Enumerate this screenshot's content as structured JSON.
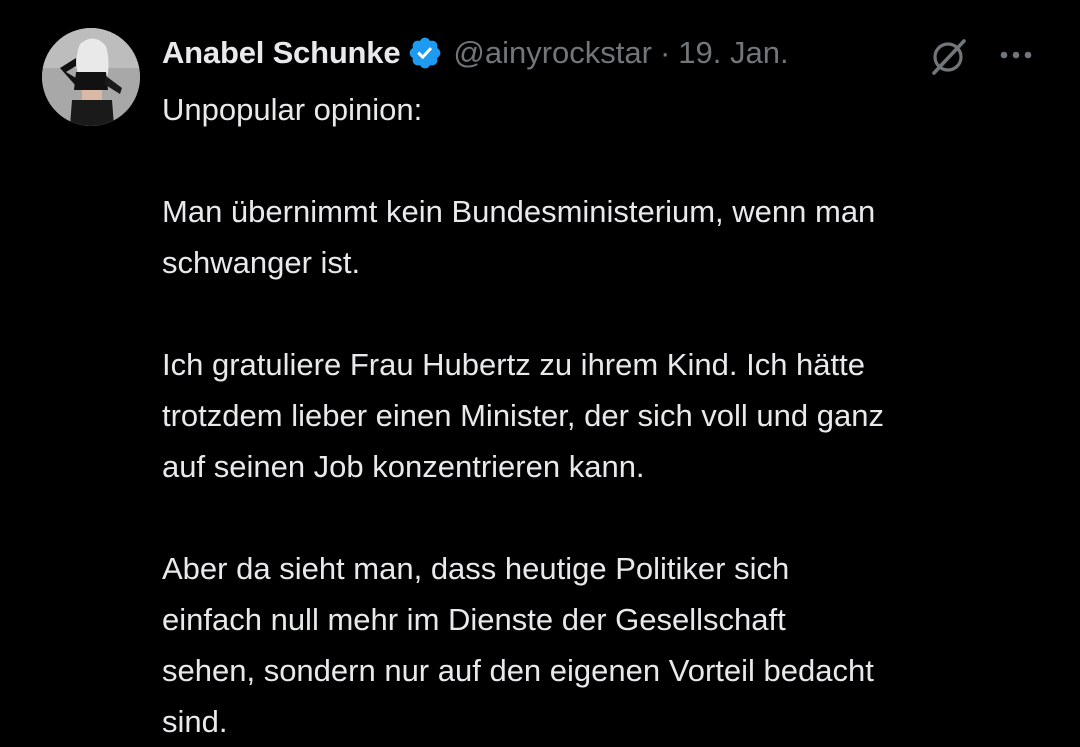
{
  "tweet": {
    "author": {
      "display_name": "Anabel Schunke",
      "handle": "@ainyrockstar",
      "verified": true
    },
    "separator": "·",
    "date": "19. Jan.",
    "paragraphs": [
      [
        "Unpopular opinion:"
      ],
      [
        "Man übernimmt kein Bundesministerium, wenn man",
        "schwanger ist."
      ],
      [
        "Ich gratuliere Frau Hubertz zu ihrem Kind. Ich hätte",
        "trotzdem lieber einen Minister, der sich voll und ganz",
        "auf seinen Job konzentrieren kann."
      ],
      [
        "Aber da sieht man, dass heutige Politiker sich",
        "einfach null mehr im Dienste der Gesellschaft",
        "sehen, sondern nur auf den eigenen Vorteil bedacht",
        "sind."
      ]
    ]
  },
  "icons": {
    "verified": "verified-badge-icon",
    "grok": "grok-icon",
    "more": "more-options-icon"
  },
  "colors": {
    "background": "#000000",
    "text": "#e7e9ea",
    "secondary": "#71767b",
    "verified_blue": "#1d9bf0"
  }
}
